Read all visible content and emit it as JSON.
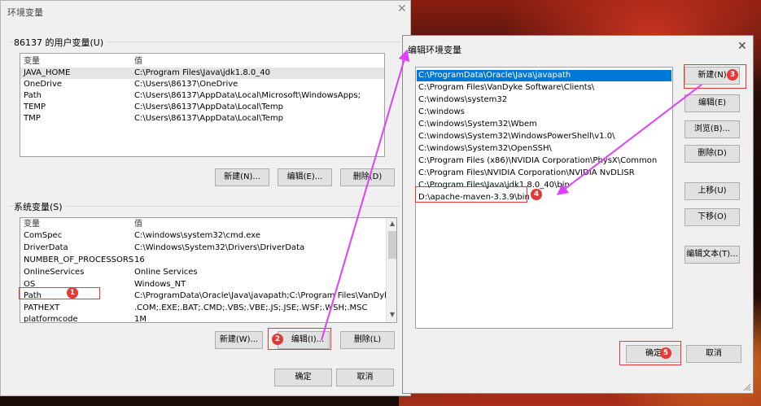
{
  "env": {
    "title": "环境变量",
    "close": "✕",
    "user_section": "86137 的用户变量(U)",
    "system_section": "系统变量(S)",
    "col_var": "变量",
    "col_val": "值",
    "user_vars": [
      {
        "name": "JAVA_HOME",
        "value": "C:\\Program Files\\Java\\jdk1.8.0_40"
      },
      {
        "name": "OneDrive",
        "value": "C:\\Users\\86137\\OneDrive"
      },
      {
        "name": "Path",
        "value": "C:\\Users\\86137\\AppData\\Local\\Microsoft\\WindowsApps;"
      },
      {
        "name": "TEMP",
        "value": "C:\\Users\\86137\\AppData\\Local\\Temp"
      },
      {
        "name": "TMP",
        "value": "C:\\Users\\86137\\AppData\\Local\\Temp"
      }
    ],
    "sys_vars": [
      {
        "name": "ComSpec",
        "value": "C:\\windows\\system32\\cmd.exe"
      },
      {
        "name": "DriverData",
        "value": "C:\\Windows\\System32\\Drivers\\DriverData"
      },
      {
        "name": "NUMBER_OF_PROCESSORS",
        "value": "16"
      },
      {
        "name": "OnlineServices",
        "value": "Online Services"
      },
      {
        "name": "OS",
        "value": "Windows_NT"
      },
      {
        "name": "Path",
        "value": "C:\\ProgramData\\Oracle\\Java\\javapath;C:\\Program Files\\VanDyke S..."
      },
      {
        "name": "PATHEXT",
        "value": ".COM;.EXE;.BAT;.CMD;.VBS;.VBE;.JS;.JSE;.WSF;.WSH;.MSC"
      },
      {
        "name": "platformcode",
        "value": "1M"
      }
    ],
    "user_buttons": {
      "new": "新建(N)...",
      "edit": "编辑(E)...",
      "delete": "删除(D)"
    },
    "sys_buttons": {
      "new": "新建(W)...",
      "edit": "编辑(I)...",
      "delete": "删除(L)"
    },
    "ok": "确定",
    "cancel": "取消"
  },
  "edit": {
    "title": "编辑环境变量",
    "close": "✕",
    "paths": [
      "C:\\ProgramData\\Oracle\\Java\\javapath",
      "C:\\Program Files\\VanDyke Software\\Clients\\",
      "C:\\windows\\system32",
      "C:\\windows",
      "C:\\windows\\System32\\Wbem",
      "C:\\windows\\System32\\WindowsPowerShell\\v1.0\\",
      "C:\\windows\\System32\\OpenSSH\\",
      "C:\\Program Files (x86)\\NVIDIA Corporation\\PhysX\\Common",
      "C:\\Program Files\\NVIDIA Corporation\\NVIDIA NvDLISR",
      "C:\\Program Files\\Java\\jdk1.8.0_40\\bin",
      "D:\\apache-maven-3.3.9\\bin"
    ],
    "buttons": {
      "new": "新建(N)",
      "edit": "编辑(E)",
      "browse": "浏览(B)...",
      "delete": "删除(D)",
      "up": "上移(U)",
      "down": "下移(O)",
      "edit_text": "编辑文本(T)..."
    },
    "ok": "确定",
    "cancel": "取消"
  },
  "badges": [
    "1",
    "2",
    "3",
    "4",
    "5"
  ],
  "colors": {
    "annotation": "#e53935",
    "arrow": "#e040fb",
    "selection": "#0078d7"
  }
}
